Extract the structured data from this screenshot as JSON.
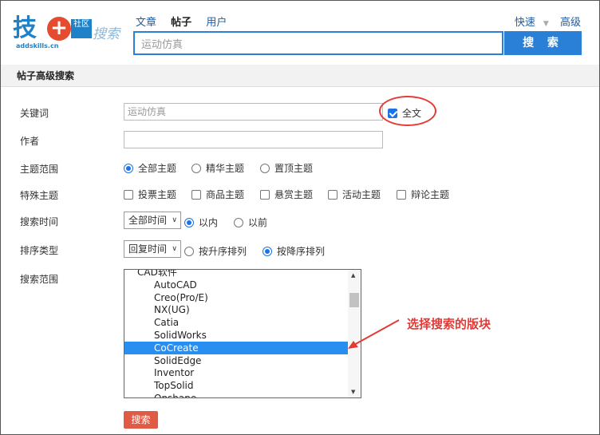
{
  "logo": {
    "main": "技",
    "plus": "+",
    "badge": "社区",
    "search_word": "搜索",
    "domain": "addskills.cn"
  },
  "nav": {
    "tabs": [
      "文章",
      "帖子",
      "用户"
    ],
    "active": "帖子"
  },
  "top_right": {
    "quick": "快速",
    "advanced": "高级"
  },
  "search": {
    "value": "运动仿真",
    "button": "搜 索"
  },
  "section_title": "帖子高级搜索",
  "form": {
    "keyword_label": "关键词",
    "keyword_value": "运动仿真",
    "fulltext_label": "全文",
    "fulltext_checked": true,
    "author_label": "作者",
    "author_value": "",
    "scope_label": "主题范围",
    "scope_options": [
      "全部主题",
      "精华主题",
      "置顶主题"
    ],
    "scope_selected": "全部主题",
    "special_label": "特殊主题",
    "special_options": [
      "投票主题",
      "商品主题",
      "悬赏主题",
      "活动主题",
      "辩论主题"
    ],
    "time_label": "搜索时间",
    "time_select": "全部时间",
    "time_options": [
      "以内",
      "以前"
    ],
    "time_selected": "以内",
    "sort_label": "排序类型",
    "sort_select": "回复时间",
    "sort_options": [
      "按升序排列",
      "按降序排列"
    ],
    "sort_selected": "按降序排列",
    "range_label": "搜索范围",
    "range_items": [
      {
        "label": "CAD软件",
        "group": true
      },
      {
        "label": "AutoCAD"
      },
      {
        "label": "Creo(Pro/E)"
      },
      {
        "label": "NX(UG)"
      },
      {
        "label": "Catia"
      },
      {
        "label": "SolidWorks"
      },
      {
        "label": "CoCreate",
        "selected": true
      },
      {
        "label": "SolidEdge"
      },
      {
        "label": "Inventor"
      },
      {
        "label": "TopSolid"
      },
      {
        "label": "Onshape"
      }
    ],
    "submit": "搜索"
  },
  "annotation": "选择搜索的版块",
  "colors": {
    "accent": "#2a7fd6",
    "annotation": "#e53935",
    "submit": "#e05a45"
  }
}
